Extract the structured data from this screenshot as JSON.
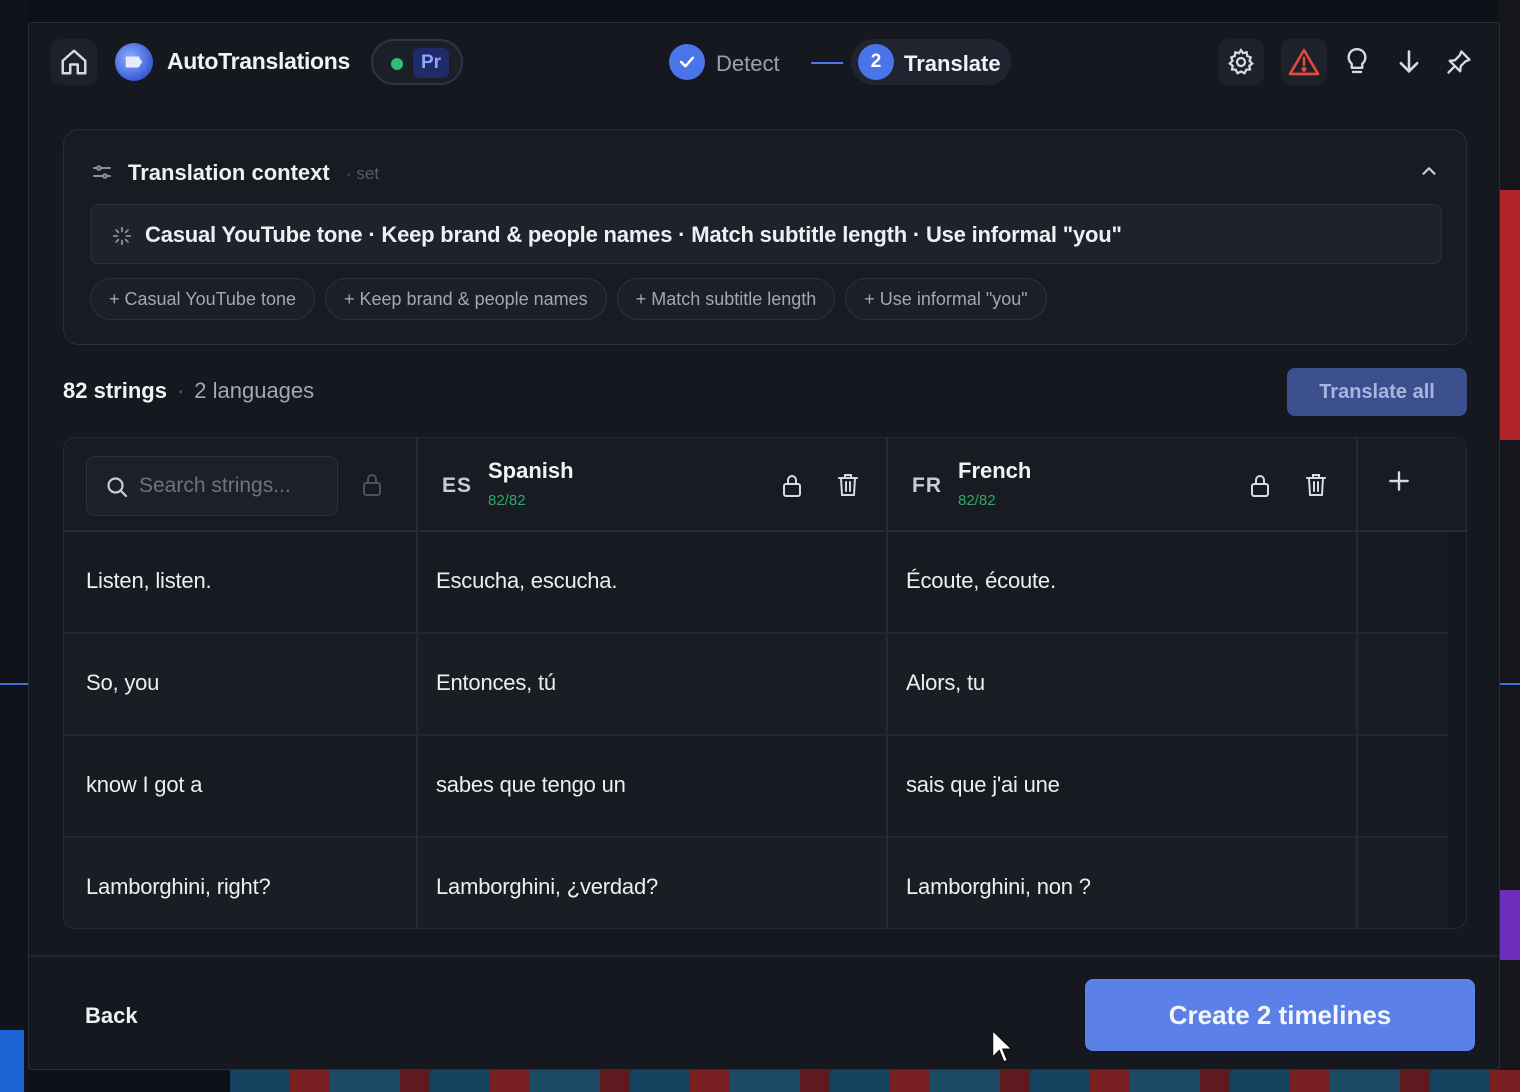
{
  "app": {
    "title": "AutoTranslations",
    "host_badge": "Pr",
    "host_status_color": "#2fbf71"
  },
  "steps": [
    {
      "label": "Detect",
      "state": "complete"
    },
    {
      "number": "2",
      "label": "Translate",
      "state": "active"
    }
  ],
  "toolbar": {
    "icons": [
      "settings-icon",
      "warning-icon",
      "lightbulb-icon",
      "download-icon",
      "pin-icon"
    ]
  },
  "context": {
    "title": "Translation context",
    "status": "· set",
    "summary": "Casual YouTube tone · Keep brand & people names · Match subtitle length · Use informal \"you\"",
    "chips": [
      "+ Casual YouTube tone",
      "+ Keep brand & people names",
      "+ Match subtitle length",
      "+ Use informal \"you\""
    ]
  },
  "summary": {
    "strings": "82 strings",
    "separator": "·",
    "languages": "2 languages",
    "translate_all": "Translate all"
  },
  "table": {
    "search_placeholder": "Search strings...",
    "languages": [
      {
        "code": "ES",
        "name": "Spanish",
        "progress": "82/82"
      },
      {
        "code": "FR",
        "name": "French",
        "progress": "82/82"
      }
    ],
    "rows": [
      {
        "source": "Listen, listen.",
        "es": "Escucha, escucha.",
        "fr": "Écoute, écoute."
      },
      {
        "source": "So, you",
        "es": "Entonces, tú",
        "fr": "Alors, tu"
      },
      {
        "source": "know I got a",
        "es": "sabes que tengo un",
        "fr": "sais que j'ai une"
      },
      {
        "source": "Lamborghini, right?",
        "es": "Lamborghini, ¿verdad?",
        "fr": "Lamborghini, non ?"
      }
    ]
  },
  "footer": {
    "back": "Back",
    "create": "Create 2 timelines"
  },
  "colors": {
    "accent": "#4a74e8",
    "primary_button": "#5b80e8",
    "warning": "#e24a3b",
    "progress": "#2fa66a"
  }
}
